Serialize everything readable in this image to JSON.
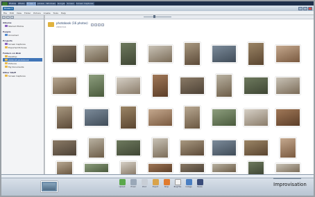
{
  "taskbar": {
    "items": [
      {
        "label": "Photos",
        "active": false
      },
      {
        "label": "iPhoto",
        "active": false
      },
      {
        "label": "Picasa 3",
        "active": true
      },
      {
        "label": "picasa - Windows",
        "active": false
      },
      {
        "label": "Google",
        "active": false
      },
      {
        "label": "Screen",
        "active": false
      },
      {
        "label": "Screen Captures",
        "active": false
      }
    ]
  },
  "app": {
    "title": "Picasa 3"
  },
  "menu": {
    "items": [
      "File",
      "Edit",
      "View",
      "Folder",
      "Picture",
      "Create",
      "Tools",
      "Help"
    ]
  },
  "left_panel": {
    "sections": [
      {
        "title": "Albums",
        "rows": [
          {
            "label": "Starred Photos",
            "icon": "purple"
          }
        ]
      },
      {
        "title": "People",
        "rows": [
          {
            "label": "Unnamed",
            "icon": "blue"
          }
        ]
      },
      {
        "title": "Projects",
        "rows": [
          {
            "label": "Screen Captures",
            "icon": "purple"
          },
          {
            "label": "Exported Pictures",
            "icon": "yellow"
          }
        ]
      },
      {
        "title": "Folders on Disk",
        "rows": [
          {
            "label": "Desktop",
            "icon": "yellow"
          },
          {
            "label": "2009-03 photobook",
            "icon": "yellow",
            "selected": true
          },
          {
            "label": "Pictures",
            "icon": "yellow"
          },
          {
            "label": "My Documents",
            "icon": "yellow"
          }
        ]
      },
      {
        "title": "Other Stuff",
        "rows": [
          {
            "label": "Screen Captures",
            "icon": "yellow"
          }
        ]
      }
    ]
  },
  "folder": {
    "title": "photobook (16 photos)",
    "subtitle": "2009/3/14"
  },
  "colors": {
    "selection": "#3f74b7",
    "brand": "#2e6ea8"
  },
  "bottom": {
    "tools": [
      {
        "label": "Upload",
        "color": "#5aa84c"
      },
      {
        "label": "Email",
        "color": "#9aa8b8"
      },
      {
        "label": "Print",
        "color": "#c8ced6"
      },
      {
        "label": "Export",
        "color": "#d9a34a"
      },
      {
        "label": "Shop",
        "color": "#e07b2e"
      },
      {
        "label": "BlogThis",
        "color": "#f2f2f2"
      },
      {
        "label": "Collage",
        "color": "#4a7fc2"
      },
      {
        "label": "Movie",
        "color": "#3b4d7a"
      }
    ],
    "caption": "Improvisation"
  },
  "icons": [
    "folder-icon",
    "star-icon",
    "upload-icon",
    "email-icon",
    "print-icon",
    "export-icon",
    "shop-icon",
    "blog-icon",
    "collage-icon",
    "movie-icon"
  ]
}
